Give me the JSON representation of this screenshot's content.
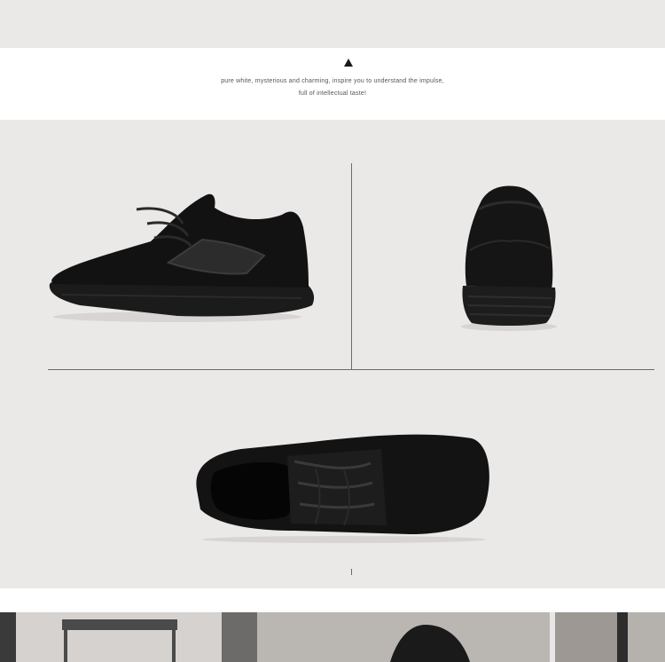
{
  "intro": {
    "line1": "pure white, mysterious and charming, inspire you to understand the impulse,",
    "line2": "full of intellectual taste!"
  },
  "colors": {
    "background": "#ebe8e8",
    "shoe": "#141414",
    "divider": "#6a6a6a"
  },
  "icons": [
    "triangle-up-icon"
  ]
}
